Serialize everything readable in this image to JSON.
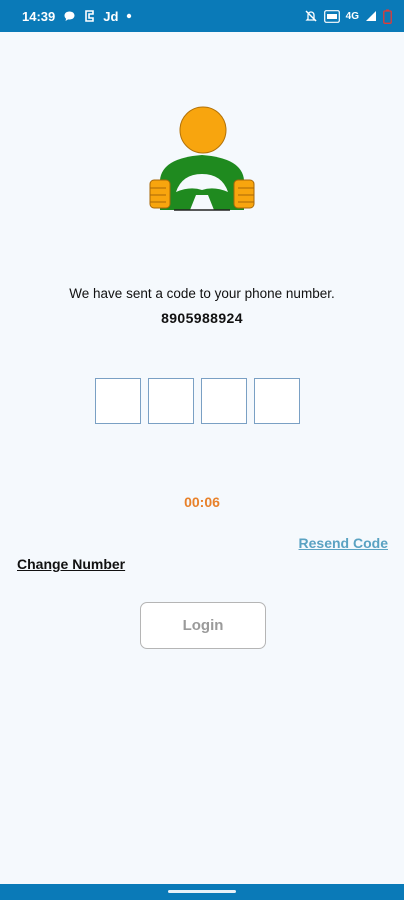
{
  "status_bar": {
    "time": "14:39",
    "app_label": "Jd",
    "network": "4G",
    "icons": [
      "chat-bubble-icon",
      "app-icon",
      "dot-icon",
      "mute-icon",
      "volte-icon",
      "signal-icon",
      "battery-icon"
    ]
  },
  "verify": {
    "message": "We have sent a code to your phone number.",
    "phone": "8905988924",
    "otp_digits": [
      "",
      "",
      "",
      ""
    ],
    "timer": "00:06",
    "resend_label": "Resend Code",
    "change_number_label": "Change Number",
    "login_label": "Login"
  },
  "colors": {
    "status_bar": "#0a7ab8",
    "background": "#f5f9fd",
    "timer": "#e8812a",
    "resend": "#5aa2c2",
    "head": "#f8a50e",
    "wheel": "#1f8a1f"
  }
}
